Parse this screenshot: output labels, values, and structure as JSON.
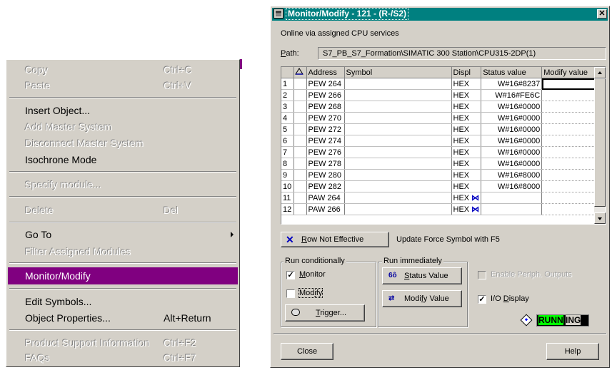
{
  "context_menu": {
    "items": [
      {
        "label": "Copy",
        "shortcut": "Ctrl+C",
        "enabled": false
      },
      {
        "label": "Paste",
        "shortcut": "Ctrl+V",
        "enabled": false
      },
      {
        "label": "Insert Object...",
        "shortcut": "",
        "enabled": true
      },
      {
        "label": "Add Master System",
        "shortcut": "",
        "enabled": false
      },
      {
        "label": "Disconnect Master System",
        "shortcut": "",
        "enabled": false
      },
      {
        "label": "Isochrone Mode",
        "shortcut": "",
        "enabled": true
      },
      {
        "label": "Specify module...",
        "shortcut": "",
        "enabled": false
      },
      {
        "label": "Delete",
        "shortcut": "Del",
        "enabled": false
      },
      {
        "label": "Go To",
        "shortcut": "",
        "enabled": true,
        "submenu": true
      },
      {
        "label": "Filter Assigned Modules",
        "shortcut": "",
        "enabled": false
      },
      {
        "label": "Monitor/Modify",
        "shortcut": "",
        "enabled": true,
        "selected": true
      },
      {
        "label": "Edit Symbols...",
        "shortcut": "",
        "enabled": true
      },
      {
        "label": "Object Properties...",
        "shortcut": "Alt+Return",
        "enabled": true
      },
      {
        "label": "Product Support Information",
        "shortcut": "Ctrl+F2",
        "enabled": false
      },
      {
        "label": "FAQs",
        "shortcut": "Ctrl+F7",
        "enabled": false
      }
    ],
    "selected_color": "#800080"
  },
  "dialog": {
    "title": "Monitor/Modify - 121 - (R-/S2)",
    "close_glyph": "✕",
    "online_text": "Online via assigned CPU services",
    "path_label": "Path:",
    "path_value": "S7_PB_S7_Formation\\SIMATIC 300 Station\\CPU315-2DP(1)",
    "table": {
      "headers": [
        "Address",
        "Symbol",
        "Displ",
        "Status value",
        "Modify value"
      ],
      "rows": [
        {
          "n": "1",
          "address": "PEW  264",
          "symbol": "",
          "display": "HEX",
          "status": "W#16#8237",
          "modify": ""
        },
        {
          "n": "2",
          "address": "PEW  266",
          "symbol": "",
          "display": "HEX",
          "status": "W#16#FE6C",
          "modify": ""
        },
        {
          "n": "3",
          "address": "PEW  268",
          "symbol": "",
          "display": "HEX",
          "status": "W#16#0000",
          "modify": ""
        },
        {
          "n": "4",
          "address": "PEW  270",
          "symbol": "",
          "display": "HEX",
          "status": "W#16#0000",
          "modify": ""
        },
        {
          "n": "5",
          "address": "PEW  272",
          "symbol": "",
          "display": "HEX",
          "status": "W#16#0000",
          "modify": ""
        },
        {
          "n": "6",
          "address": "PEW  274",
          "symbol": "",
          "display": "HEX",
          "status": "W#16#0000",
          "modify": ""
        },
        {
          "n": "7",
          "address": "PEW  276",
          "symbol": "",
          "display": "HEX",
          "status": "W#16#0000",
          "modify": ""
        },
        {
          "n": "8",
          "address": "PEW  278",
          "symbol": "",
          "display": "HEX",
          "status": "W#16#0000",
          "modify": ""
        },
        {
          "n": "9",
          "address": "PEW  280",
          "symbol": "",
          "display": "HEX",
          "status": "W#16#8000",
          "modify": ""
        },
        {
          "n": "10",
          "address": "PEW  282",
          "symbol": "",
          "display": "HEX",
          "status": "W#16#8000",
          "modify": ""
        },
        {
          "n": "11",
          "address": "PAW  264",
          "symbol": "",
          "display": "HEX",
          "status": "",
          "modify": ""
        },
        {
          "n": "12",
          "address": "PAW  266",
          "symbol": "",
          "display": "HEX",
          "status": "",
          "modify": ""
        }
      ]
    },
    "row_not_effective_label": "Row Not Effective",
    "row_not_effective_glyph": "✕",
    "force_update_text": "Update Force Symbol with F5",
    "run_conditionally": {
      "label": "Run conditionally",
      "monitor_label": "Monitor",
      "monitor_checked": true,
      "modify_label": "Modify",
      "modify_checked": false,
      "trigger_label": "Trigger..."
    },
    "run_immediately": {
      "label": "Run immediately",
      "status_value_label": "Status Value",
      "modify_value_label": "Modify Value"
    },
    "enable_periph_label": "Enable Periph. Outputs",
    "io_display_label": "I/O Display",
    "io_display_checked": true,
    "running_status": "RUNNING",
    "close_label": "Close",
    "help_label": "Help",
    "colors": {
      "titlebar": "#008080",
      "running": "#00ff00"
    }
  }
}
